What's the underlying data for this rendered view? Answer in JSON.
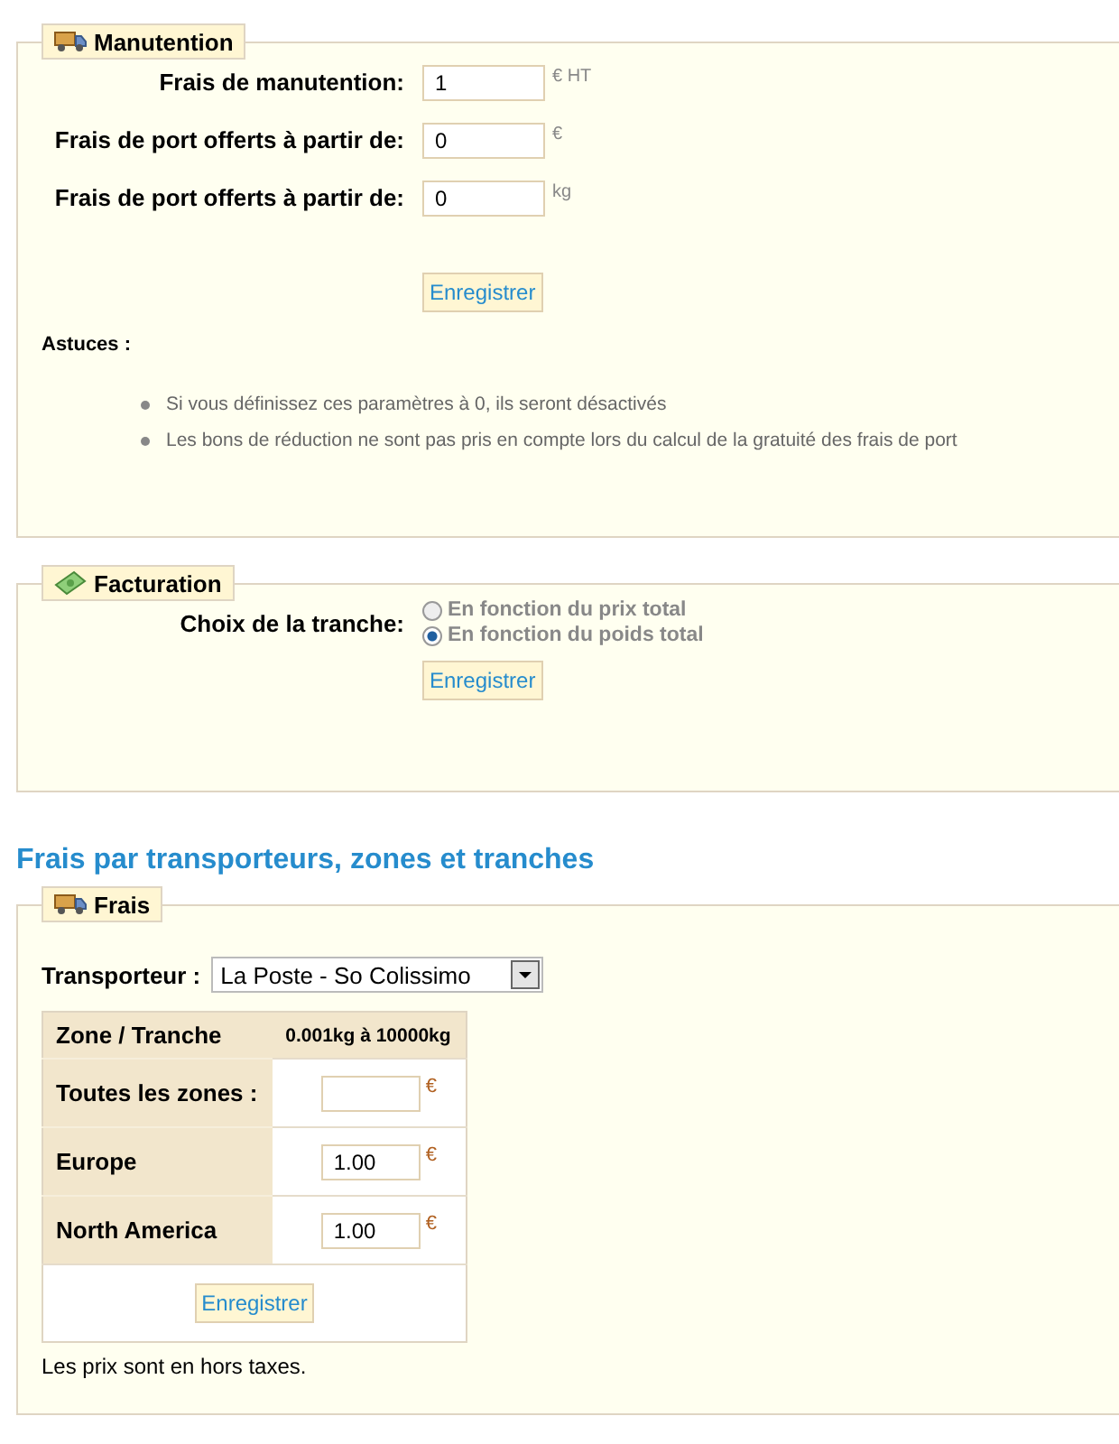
{
  "handling": {
    "legend": "Manutention",
    "fields": [
      {
        "label": "Frais de manutention:",
        "value": "1",
        "unit": "€ HT"
      },
      {
        "label": "Frais de port offerts à partir de:",
        "value": "0",
        "unit": "€"
      },
      {
        "label": "Frais de port offerts à partir de:",
        "value": "0",
        "unit": "kg"
      }
    ],
    "button": "Enregistrer",
    "tips_title": "Astuces :",
    "tips": [
      "Si vous définissez ces paramètres à 0, ils seront désactivés",
      "Les bons de réduction ne sont pas pris en compte lors du calcul de la gratuité des frais de port"
    ]
  },
  "billing": {
    "legend": "Facturation",
    "label": "Choix de la tranche:",
    "options": [
      {
        "label": "En fonction du prix total",
        "selected": false
      },
      {
        "label": "En fonction du poids total",
        "selected": true
      }
    ],
    "button": "Enregistrer"
  },
  "heading": "Frais par transporteurs, zones et tranches",
  "fees": {
    "legend": "Frais",
    "carrier_label": "Transporteur :",
    "carrier": "La Poste - So Colissimo",
    "table": {
      "columns": [
        "Zone / Tranche",
        "0.001kg à 10000kg"
      ],
      "rows": [
        {
          "zone": "Toutes les zones :",
          "value": "",
          "unit": "€"
        },
        {
          "zone": "Europe",
          "value": "1.00",
          "unit": "€"
        },
        {
          "zone": "North America",
          "value": "1.00",
          "unit": "€"
        }
      ]
    },
    "button": "Enregistrer",
    "note": "Les prix sont en hors taxes."
  }
}
